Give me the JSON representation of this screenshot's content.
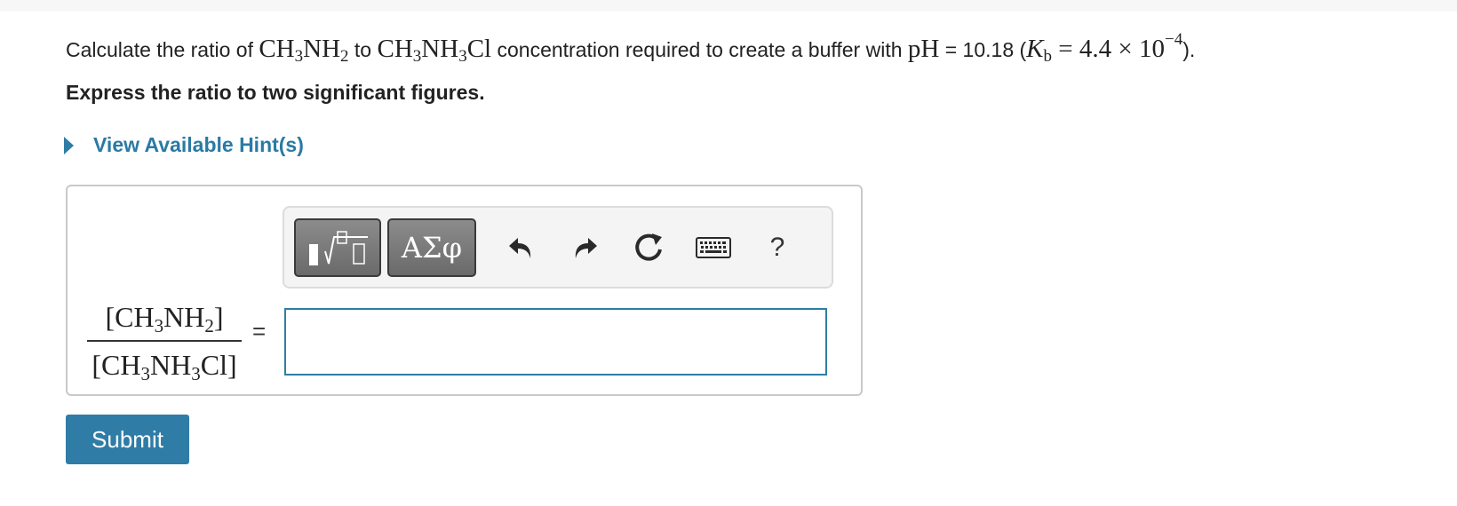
{
  "question": {
    "prefix": "Calculate the ratio of ",
    "species_a": {
      "main": "CH",
      "sub1": "3",
      "mid": "NH",
      "sub2": "2"
    },
    "connector": " to ",
    "species_b": {
      "main": "CH",
      "sub1": "3",
      "mid": "NH",
      "sub2": "3",
      "tail": "Cl"
    },
    "middle_text": " concentration required to create a buffer with ",
    "ph_symbol": "pH",
    "ph_value": " = 10.18 (",
    "kb_symbol": "K",
    "kb_sub": "b",
    "kb_value": " = 4.4 × 10",
    "kb_exp": "−4",
    "suffix": ")."
  },
  "instruction": "Express the ratio to two significant figures.",
  "hint": {
    "label": "View Available Hint(s)"
  },
  "toolbar": {
    "templates_icon": "templates-icon",
    "symbols_label": "ΑΣφ",
    "undo_icon": "undo-icon",
    "redo_icon": "redo-icon",
    "reset_icon": "reset-icon",
    "keyboard_icon": "keyboard-icon",
    "help_label": "?"
  },
  "fraction": {
    "numerator": {
      "open": "[CH",
      "sub1": "3",
      "mid": "NH",
      "sub2": "2",
      "close": "]"
    },
    "denominator": {
      "open": "[CH",
      "sub1": "3",
      "mid": "NH",
      "sub2": "3",
      "close": "Cl]"
    },
    "equals": "="
  },
  "answer_input": {
    "value": "",
    "placeholder": ""
  },
  "submit": {
    "label": "Submit"
  },
  "colors": {
    "accent": "#2f7da6",
    "toolbar_button": "#777777",
    "border": "#c9c9c9"
  }
}
